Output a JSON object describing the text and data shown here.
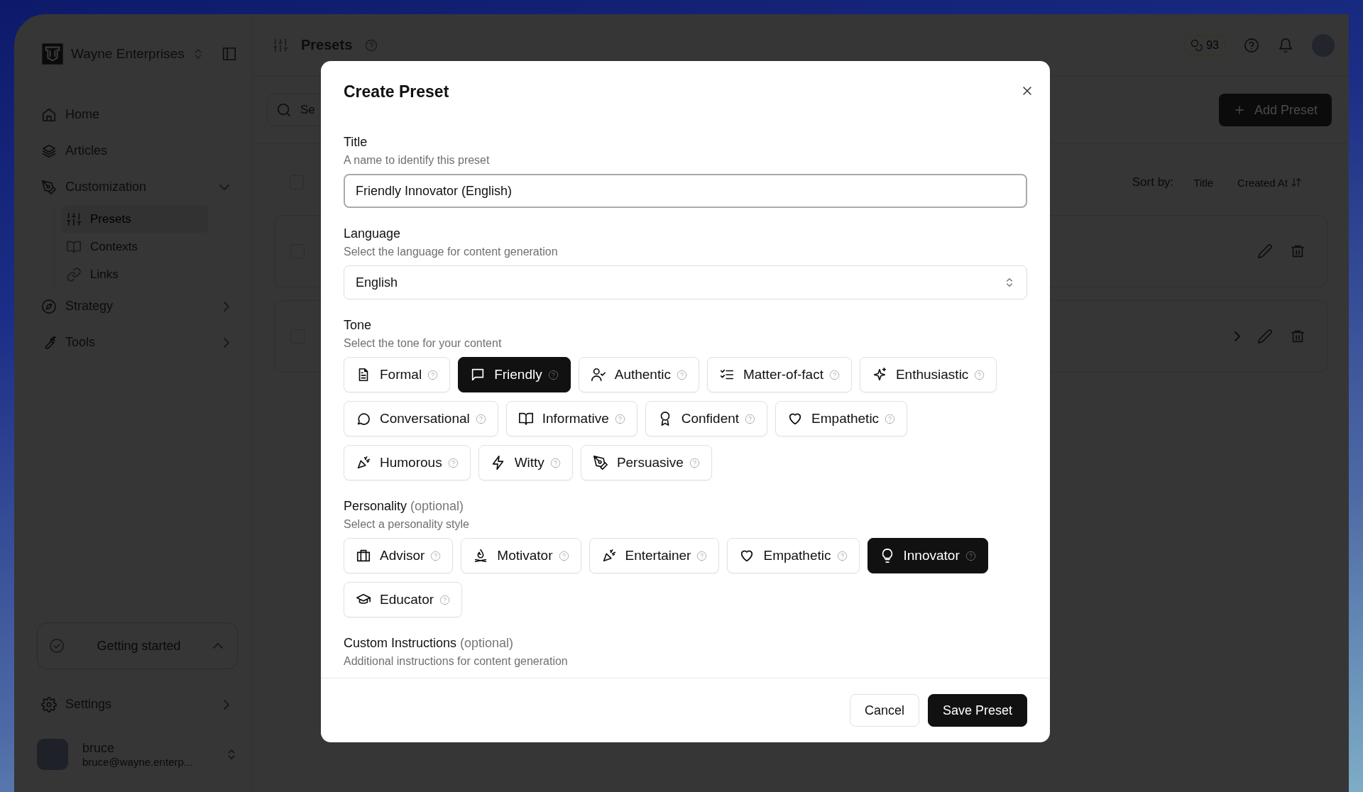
{
  "sidebar": {
    "org": {
      "name": "Wayne Enterprises"
    },
    "nav": [
      {
        "label": "Home"
      },
      {
        "label": "Articles"
      },
      {
        "label": "Customization",
        "expanded": true,
        "children": [
          {
            "label": "Presets",
            "selected": true
          },
          {
            "label": "Contexts",
            "selected": false
          },
          {
            "label": "Links",
            "selected": false
          }
        ]
      },
      {
        "label": "Strategy",
        "expanded": false
      },
      {
        "label": "Tools",
        "expanded": false
      }
    ],
    "getting_started": {
      "label": "Getting started"
    },
    "settings": {
      "label": "Settings"
    },
    "user": {
      "name": "bruce",
      "email": "bruce@wayne.enterp..."
    }
  },
  "header": {
    "title": "Presets",
    "credits": "93"
  },
  "toolbar": {
    "search_placeholder": "Se",
    "add_button": "Add Preset"
  },
  "sort": {
    "select_all": {
      "checked": false
    },
    "label": "Sort by:",
    "options": [
      {
        "label": "Title"
      },
      {
        "label": "Created At"
      }
    ]
  },
  "rows": [
    {
      "expandable": false,
      "checked": false
    },
    {
      "expandable": true,
      "checked": false
    }
  ],
  "modal": {
    "title": "Create Preset",
    "title_field": {
      "label": "Title",
      "hint": "A name to identify this preset",
      "value": "Friendly Innovator (English)"
    },
    "language_field": {
      "label": "Language",
      "hint": "Select the language for content generation",
      "value": "English"
    },
    "tone": {
      "label": "Tone",
      "hint": "Select the tone for your content",
      "options": [
        {
          "label": "Formal",
          "selected": false
        },
        {
          "label": "Friendly",
          "selected": true
        },
        {
          "label": "Authentic",
          "selected": false
        },
        {
          "label": "Matter-of-fact",
          "selected": false
        },
        {
          "label": "Enthusiastic",
          "selected": false
        },
        {
          "label": "Conversational",
          "selected": false
        },
        {
          "label": "Informative",
          "selected": false
        },
        {
          "label": "Confident",
          "selected": false
        },
        {
          "label": "Empathetic",
          "selected": false
        },
        {
          "label": "Humorous",
          "selected": false
        },
        {
          "label": "Witty",
          "selected": false
        },
        {
          "label": "Persuasive",
          "selected": false
        }
      ]
    },
    "personality": {
      "label": "Personality",
      "note": "(optional)",
      "hint": "Select a personality style",
      "options": [
        {
          "label": "Advisor",
          "selected": false
        },
        {
          "label": "Motivator",
          "selected": false
        },
        {
          "label": "Entertainer",
          "selected": false
        },
        {
          "label": "Empathetic",
          "selected": false
        },
        {
          "label": "Innovator",
          "selected": true
        },
        {
          "label": "Educator",
          "selected": false
        }
      ]
    },
    "custom": {
      "label": "Custom Instructions",
      "note": "(optional)",
      "hint": "Additional instructions for content generation"
    },
    "buttons": {
      "cancel": "Cancel",
      "save": "Save Preset"
    }
  }
}
